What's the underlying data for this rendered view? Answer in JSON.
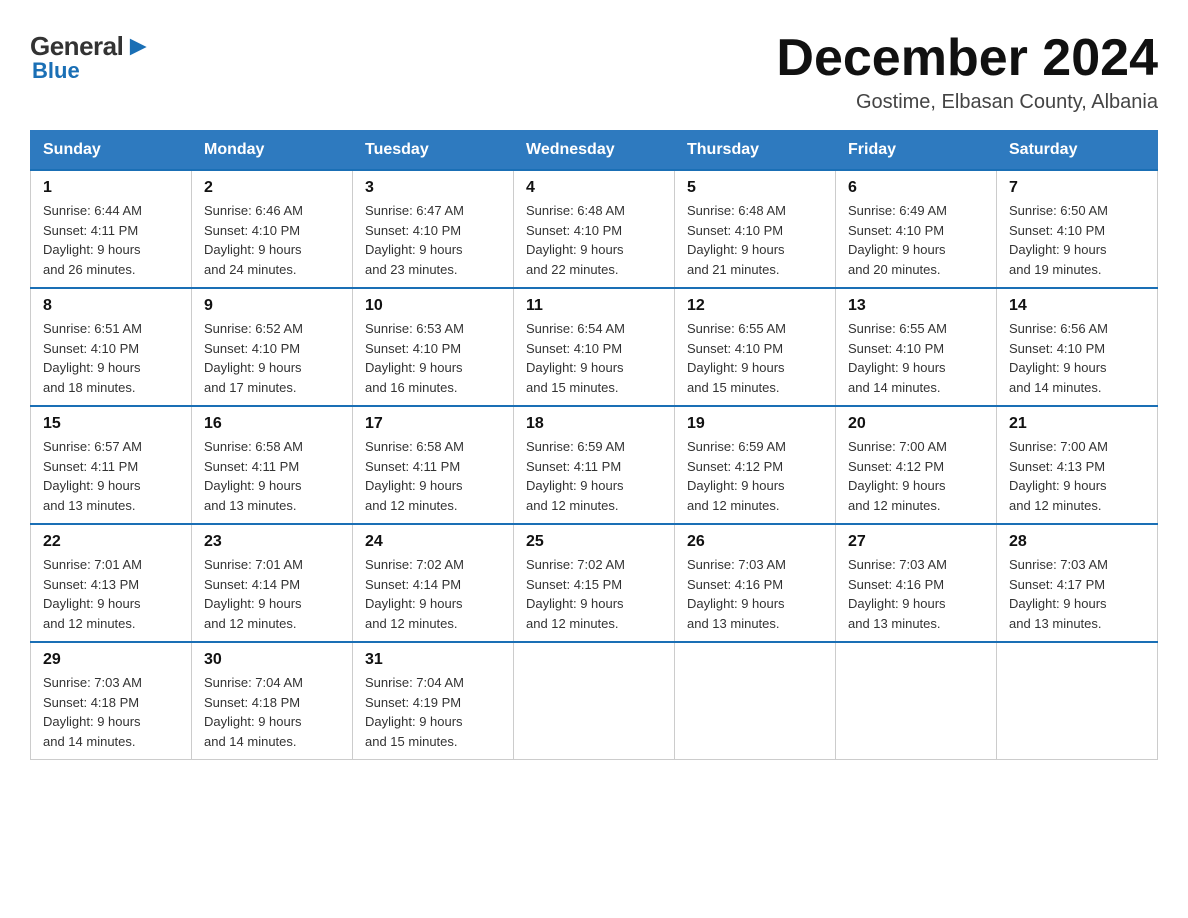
{
  "header": {
    "logo_general": "General",
    "logo_blue": "Blue",
    "main_title": "December 2024",
    "subtitle": "Gostime, Elbasan County, Albania"
  },
  "calendar": {
    "days_of_week": [
      "Sunday",
      "Monday",
      "Tuesday",
      "Wednesday",
      "Thursday",
      "Friday",
      "Saturday"
    ],
    "weeks": [
      [
        {
          "day": "1",
          "sunrise": "6:44 AM",
          "sunset": "4:11 PM",
          "daylight": "9 hours and 26 minutes."
        },
        {
          "day": "2",
          "sunrise": "6:46 AM",
          "sunset": "4:10 PM",
          "daylight": "9 hours and 24 minutes."
        },
        {
          "day": "3",
          "sunrise": "6:47 AM",
          "sunset": "4:10 PM",
          "daylight": "9 hours and 23 minutes."
        },
        {
          "day": "4",
          "sunrise": "6:48 AM",
          "sunset": "4:10 PM",
          "daylight": "9 hours and 22 minutes."
        },
        {
          "day": "5",
          "sunrise": "6:48 AM",
          "sunset": "4:10 PM",
          "daylight": "9 hours and 21 minutes."
        },
        {
          "day": "6",
          "sunrise": "6:49 AM",
          "sunset": "4:10 PM",
          "daylight": "9 hours and 20 minutes."
        },
        {
          "day": "7",
          "sunrise": "6:50 AM",
          "sunset": "4:10 PM",
          "daylight": "9 hours and 19 minutes."
        }
      ],
      [
        {
          "day": "8",
          "sunrise": "6:51 AM",
          "sunset": "4:10 PM",
          "daylight": "9 hours and 18 minutes."
        },
        {
          "day": "9",
          "sunrise": "6:52 AM",
          "sunset": "4:10 PM",
          "daylight": "9 hours and 17 minutes."
        },
        {
          "day": "10",
          "sunrise": "6:53 AM",
          "sunset": "4:10 PM",
          "daylight": "9 hours and 16 minutes."
        },
        {
          "day": "11",
          "sunrise": "6:54 AM",
          "sunset": "4:10 PM",
          "daylight": "9 hours and 15 minutes."
        },
        {
          "day": "12",
          "sunrise": "6:55 AM",
          "sunset": "4:10 PM",
          "daylight": "9 hours and 15 minutes."
        },
        {
          "day": "13",
          "sunrise": "6:55 AM",
          "sunset": "4:10 PM",
          "daylight": "9 hours and 14 minutes."
        },
        {
          "day": "14",
          "sunrise": "6:56 AM",
          "sunset": "4:10 PM",
          "daylight": "9 hours and 14 minutes."
        }
      ],
      [
        {
          "day": "15",
          "sunrise": "6:57 AM",
          "sunset": "4:11 PM",
          "daylight": "9 hours and 13 minutes."
        },
        {
          "day": "16",
          "sunrise": "6:58 AM",
          "sunset": "4:11 PM",
          "daylight": "9 hours and 13 minutes."
        },
        {
          "day": "17",
          "sunrise": "6:58 AM",
          "sunset": "4:11 PM",
          "daylight": "9 hours and 12 minutes."
        },
        {
          "day": "18",
          "sunrise": "6:59 AM",
          "sunset": "4:11 PM",
          "daylight": "9 hours and 12 minutes."
        },
        {
          "day": "19",
          "sunrise": "6:59 AM",
          "sunset": "4:12 PM",
          "daylight": "9 hours and 12 minutes."
        },
        {
          "day": "20",
          "sunrise": "7:00 AM",
          "sunset": "4:12 PM",
          "daylight": "9 hours and 12 minutes."
        },
        {
          "day": "21",
          "sunrise": "7:00 AM",
          "sunset": "4:13 PM",
          "daylight": "9 hours and 12 minutes."
        }
      ],
      [
        {
          "day": "22",
          "sunrise": "7:01 AM",
          "sunset": "4:13 PM",
          "daylight": "9 hours and 12 minutes."
        },
        {
          "day": "23",
          "sunrise": "7:01 AM",
          "sunset": "4:14 PM",
          "daylight": "9 hours and 12 minutes."
        },
        {
          "day": "24",
          "sunrise": "7:02 AM",
          "sunset": "4:14 PM",
          "daylight": "9 hours and 12 minutes."
        },
        {
          "day": "25",
          "sunrise": "7:02 AM",
          "sunset": "4:15 PM",
          "daylight": "9 hours and 12 minutes."
        },
        {
          "day": "26",
          "sunrise": "7:03 AM",
          "sunset": "4:16 PM",
          "daylight": "9 hours and 13 minutes."
        },
        {
          "day": "27",
          "sunrise": "7:03 AM",
          "sunset": "4:16 PM",
          "daylight": "9 hours and 13 minutes."
        },
        {
          "day": "28",
          "sunrise": "7:03 AM",
          "sunset": "4:17 PM",
          "daylight": "9 hours and 13 minutes."
        }
      ],
      [
        {
          "day": "29",
          "sunrise": "7:03 AM",
          "sunset": "4:18 PM",
          "daylight": "9 hours and 14 minutes."
        },
        {
          "day": "30",
          "sunrise": "7:04 AM",
          "sunset": "4:18 PM",
          "daylight": "9 hours and 14 minutes."
        },
        {
          "day": "31",
          "sunrise": "7:04 AM",
          "sunset": "4:19 PM",
          "daylight": "9 hours and 15 minutes."
        },
        null,
        null,
        null,
        null
      ]
    ]
  }
}
